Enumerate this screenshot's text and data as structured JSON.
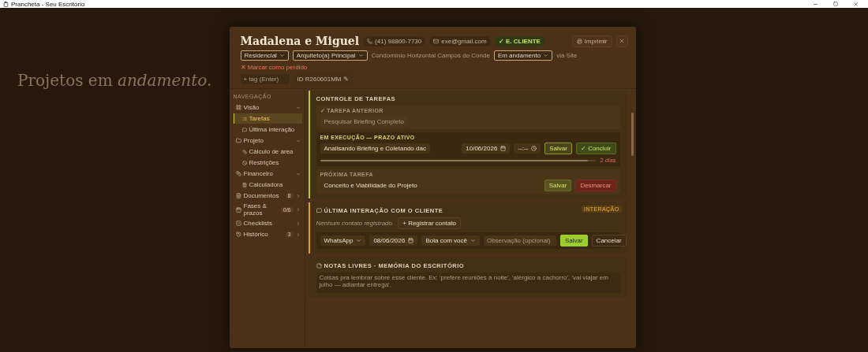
{
  "window": {
    "title": "Prancheta - Seu Escritório"
  },
  "background": {
    "heading": "Projetos em *andamento.*"
  },
  "modal": {
    "title": "Madalena e Miguel",
    "contacts": [
      {
        "kind": "phone",
        "text": "(41) 98800-7730"
      },
      {
        "kind": "email",
        "text": "exe@gmail.com"
      },
      {
        "kind": "badge",
        "text": "✓ E. CLIENTE"
      }
    ],
    "print_button": "Imprimir",
    "filters": [
      {
        "kind": "select",
        "text": "Residencial"
      },
      {
        "kind": "select",
        "text": "Arquiteto(a) Principal"
      },
      {
        "kind": "text",
        "text": "Condomínio Horizontal Campos do Conde"
      },
      {
        "kind": "select",
        "text": "Em andamento"
      },
      {
        "kind": "text",
        "text": "via Site"
      }
    ],
    "lost_link": "✕ Marcar como perdido",
    "tag_input": {
      "placeholder": "+ tag (Enter)"
    },
    "id_label": "ID R260601MM ✎"
  },
  "sidebar": {
    "heading": "NAVEGAÇÃO",
    "items": [
      {
        "label": "Visão",
        "selected": false,
        "expanded": true,
        "children": [
          {
            "label": "Tarefas",
            "selected": true
          },
          {
            "label": "Última interação",
            "selected": false
          }
        ]
      },
      {
        "label": "Projeto",
        "selected": false,
        "expanded": true,
        "children": [
          {
            "label": "Cálculo de área",
            "selected": false
          },
          {
            "label": "Restrições",
            "selected": false
          }
        ]
      },
      {
        "label": "Financeiro",
        "selected": false,
        "expanded": true,
        "children": [
          {
            "label": "Calculadora",
            "selected": false
          }
        ]
      },
      {
        "label": "Documentos",
        "selected": false,
        "expanded": false,
        "badge": "8"
      },
      {
        "label": "Fases & prazos",
        "selected": false,
        "expanded": false,
        "badge": "0/6"
      },
      {
        "label": "Checklists",
        "selected": false,
        "expanded": false
      },
      {
        "label": "Histórico",
        "selected": false,
        "expanded": false,
        "badge": "3"
      }
    ]
  },
  "tasks": {
    "title": "CONTROLE DE TAREFAS",
    "previous": {
      "label": "✓ TAREFA ANTERIOR",
      "value": "Pesquisar Briefing Completo"
    },
    "current": {
      "label": "EM EXECUÇÃO — PRAZO ATIVO",
      "value": "Analisando Briefing e Coletando dac",
      "date": "10/06/2026",
      "time": "--:--",
      "save": "Salvar",
      "complete": "✓ Concluir",
      "level": 0.97,
      "remaining": "2 dias"
    },
    "next": {
      "label": "PRÓXIMA TAREFA",
      "value": "Conceito e Viabilidade do Projeto",
      "save": "Salvar"
    },
    "discard": "Desmarcar"
  },
  "interaction": {
    "badge": "INTERAÇÃO",
    "title": "ÚLTIMA INTERAÇÃO COM O CLIENTE",
    "empty": "Nenhum contato registrado.",
    "add_button": "+ Registrar contato",
    "channel": "WhatsApp",
    "date": "08/06/2026",
    "status": "Bola com você",
    "note": {
      "placeholder": "Observação (opcional)"
    },
    "save": "Salvar",
    "cancel": "Cancelar"
  },
  "notes": {
    "title": "NOTAS LIVRES · MEMÓRIA DO ESCRITÓRIO",
    "placeholder": "Coisas pra lembrar sobre esse cliente. Ex: 'prefere reuniões à noite', 'alérgico a cachorro', 'vai viajar em julho — adiantar entrega'."
  }
}
